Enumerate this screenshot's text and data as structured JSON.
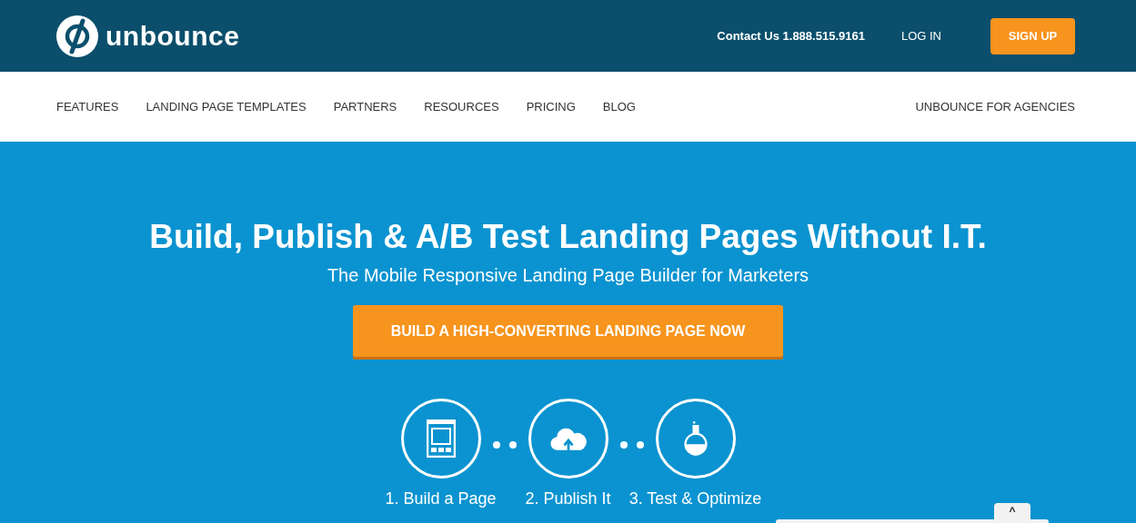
{
  "header": {
    "logo_text": "unbounce",
    "contact": "Contact Us 1.888.515.9161",
    "login": "LOG IN",
    "signup": "SIGN UP"
  },
  "nav": {
    "items": [
      {
        "label": "FEATURES"
      },
      {
        "label": "LANDING PAGE TEMPLATES"
      },
      {
        "label": "PARTNERS"
      },
      {
        "label": "RESOURCES"
      },
      {
        "label": "PRICING"
      },
      {
        "label": "BLOG"
      }
    ],
    "right": "UNBOUNCE FOR AGENCIES"
  },
  "hero": {
    "title": "Build, Publish & A/B Test Landing Pages Without I.T.",
    "subtitle": "The Mobile Responsive Landing Page Builder for Marketers",
    "cta": "BUILD A HIGH-CONVERTING LANDING PAGE NOW",
    "steps": [
      {
        "kind": "build",
        "label": "1. Build a Page"
      },
      {
        "kind": "publish",
        "label": "2. Publish It"
      },
      {
        "kind": "test",
        "label": "3. Test & Optimize"
      }
    ]
  },
  "chat_tab": {
    "icon": "^"
  }
}
